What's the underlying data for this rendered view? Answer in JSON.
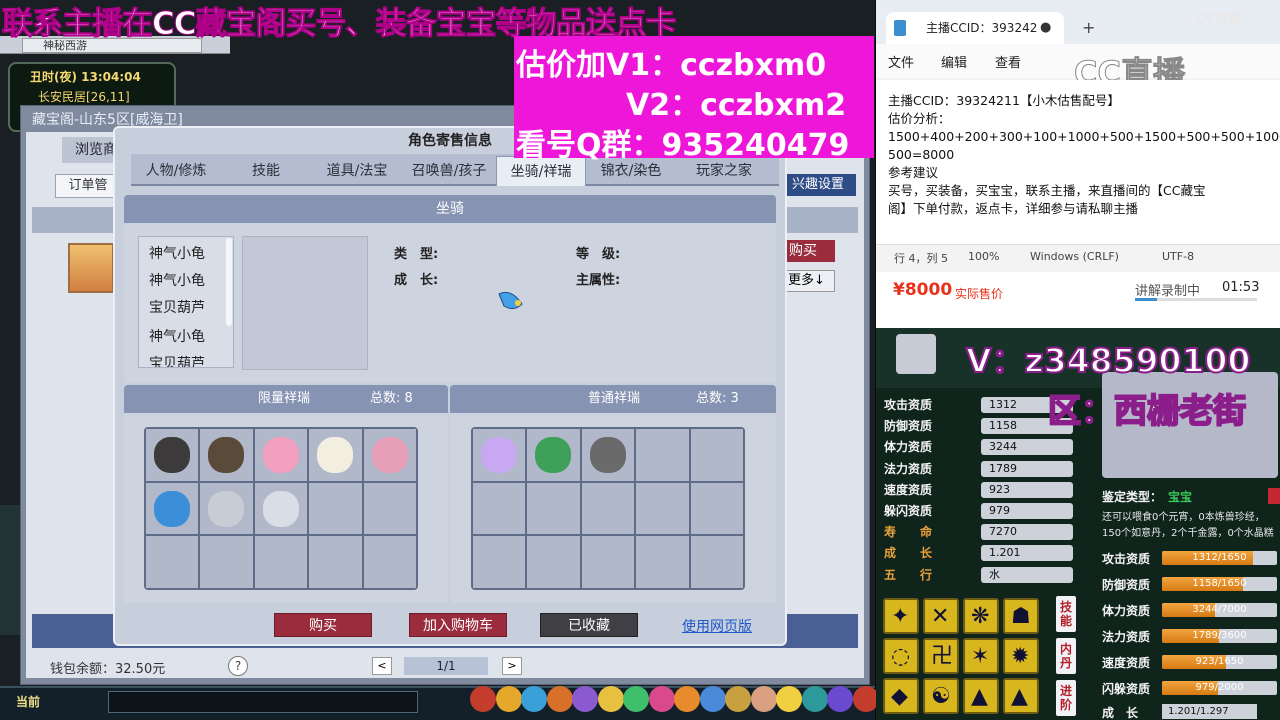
{
  "overlay": {
    "banner": "联系主播在CC藏宝阁买号、装备宝宝等物品送点卡",
    "lines": [
      "估价加V1：cczbxm0",
      "V2：cczbxm2",
      "看号Q群：935240479"
    ],
    "v_id": "V：z348590100",
    "region": "区：西栅老街",
    "cc_logo": "CC直播"
  },
  "game": {
    "window_tab": "神秘西游",
    "clock": "丑时(夜)  13:04:04",
    "location": "长安民居[26,11]",
    "zbg_title": "藏宝阁-山东5区[威海卫]",
    "browse_tab": "浏览商",
    "order_btn": "订单管",
    "interest_btn": "兴趣设置",
    "side_buy": "购买",
    "side_more": "更多↓",
    "wallet": "钱包余额：32.50元",
    "help": "?",
    "page": "1/1",
    "prev": "<",
    "next": ">",
    "current": "当前"
  },
  "dialog": {
    "title": "角色寄售信息",
    "tabs": [
      "人物/修炼",
      "技能",
      "道具/法宝",
      "召唤兽/孩子",
      "坐骑/祥瑞",
      "锦衣/染色",
      "玩家之家"
    ],
    "active_tab": 4,
    "panel_title": "坐骑",
    "mounts": [
      "神气小龟",
      "神气小龟",
      "宝贝葫芦",
      "神气小龟",
      "宝贝葫芦"
    ],
    "attrs": {
      "type": "类　型:",
      "level": "等　级:",
      "growth": "成　长:",
      "main": "主属性:"
    },
    "limited_label": "限量祥瑞",
    "limited_count_label": "总数: 8",
    "normal_label": "普通祥瑞",
    "normal_count_label": "总数: 3",
    "buy": "购买",
    "cart": "加入购物车",
    "fav": "已收藏",
    "web": "使用网页版",
    "limited_pet_colors": [
      "#3c3a3a",
      "#5a4a3a",
      "#f3a0c0",
      "#f2efe0",
      "#e8a0b8",
      "#3a8fd8",
      "#c8ccd4",
      "#d8dde6"
    ],
    "normal_pet_colors": [
      "#c8a8f0",
      "#3fa05a",
      "#6a6a6a"
    ]
  },
  "notepad": {
    "tab_title": "主播CCID：393242",
    "close": "●",
    "plus": "+",
    "menu": [
      "文件",
      "编辑",
      "查看"
    ],
    "lines": [
      "主播CCID：39324211【小木估售配号】",
      "估价分析：",
      "1500+400+200+300+100+1000+500+1500+500+500+1000+",
      "500=8000",
      "参考建议",
      "买号，买装备，买宝宝，联系主播，来直播间的【CC藏宝",
      "阁】下单付款，返点卡，详细参与请私聊主播"
    ],
    "status": [
      "行 4，列 5",
      "100%",
      "Windows (CRLF)",
      "UTF-8"
    ]
  },
  "price": {
    "value": "¥8000",
    "label": "实际售价",
    "recording": "讲解录制中",
    "time": "01:53",
    "progress": 0.18
  },
  "pet": {
    "stats": [
      {
        "label": "攻击资质",
        "value": "1312",
        "gold": false
      },
      {
        "label": "防御资质",
        "value": "1158",
        "gold": false
      },
      {
        "label": "体力资质",
        "value": "3244",
        "gold": false
      },
      {
        "label": "法力资质",
        "value": "1789",
        "gold": false
      },
      {
        "label": "速度资质",
        "value": "923",
        "gold": false
      },
      {
        "label": "躲闪资质",
        "value": "979",
        "gold": false
      },
      {
        "label": "寿　　命",
        "value": "7270",
        "gold": true
      },
      {
        "label": "成　　长",
        "value": "1.201",
        "gold": true
      },
      {
        "label": "五　　行",
        "value": "水",
        "gold": true
      }
    ],
    "identify_label": "鉴定类型：",
    "identify_value": "宝宝",
    "note1": "还可以喂食0个元宵，0本炼兽珍经，",
    "note2": "150个如意丹，2个千金露，0个水晶糕",
    "bars": [
      {
        "label": "攻击资质",
        "text": "1312/1650",
        "frac": 0.795
      },
      {
        "label": "防御资质",
        "text": "1158/1650",
        "frac": 0.702
      },
      {
        "label": "体力资质",
        "text": "3244/7000",
        "frac": 0.463
      },
      {
        "label": "法力资质",
        "text": "1789/3600",
        "frac": 0.497
      },
      {
        "label": "速度资质",
        "text": "923/1650",
        "frac": 0.559
      },
      {
        "label": "闪躲资质",
        "text": "979/2000",
        "frac": 0.49
      }
    ],
    "growth_label": "成　长",
    "growth_value": "1.201/1.297",
    "vtabs": [
      "技能",
      "内丹",
      "进阶"
    ],
    "skill_syms": [
      "✦",
      "✕",
      "❋",
      "☗",
      "◌",
      "卍",
      "✶",
      "✹",
      "◆",
      "☯",
      "▲",
      "▲"
    ]
  },
  "colors": {
    "magenta": "#ee17d9",
    "accent_red": "#9a2c3d",
    "price_red": "#e8321c",
    "gold": "#d8b61d"
  }
}
